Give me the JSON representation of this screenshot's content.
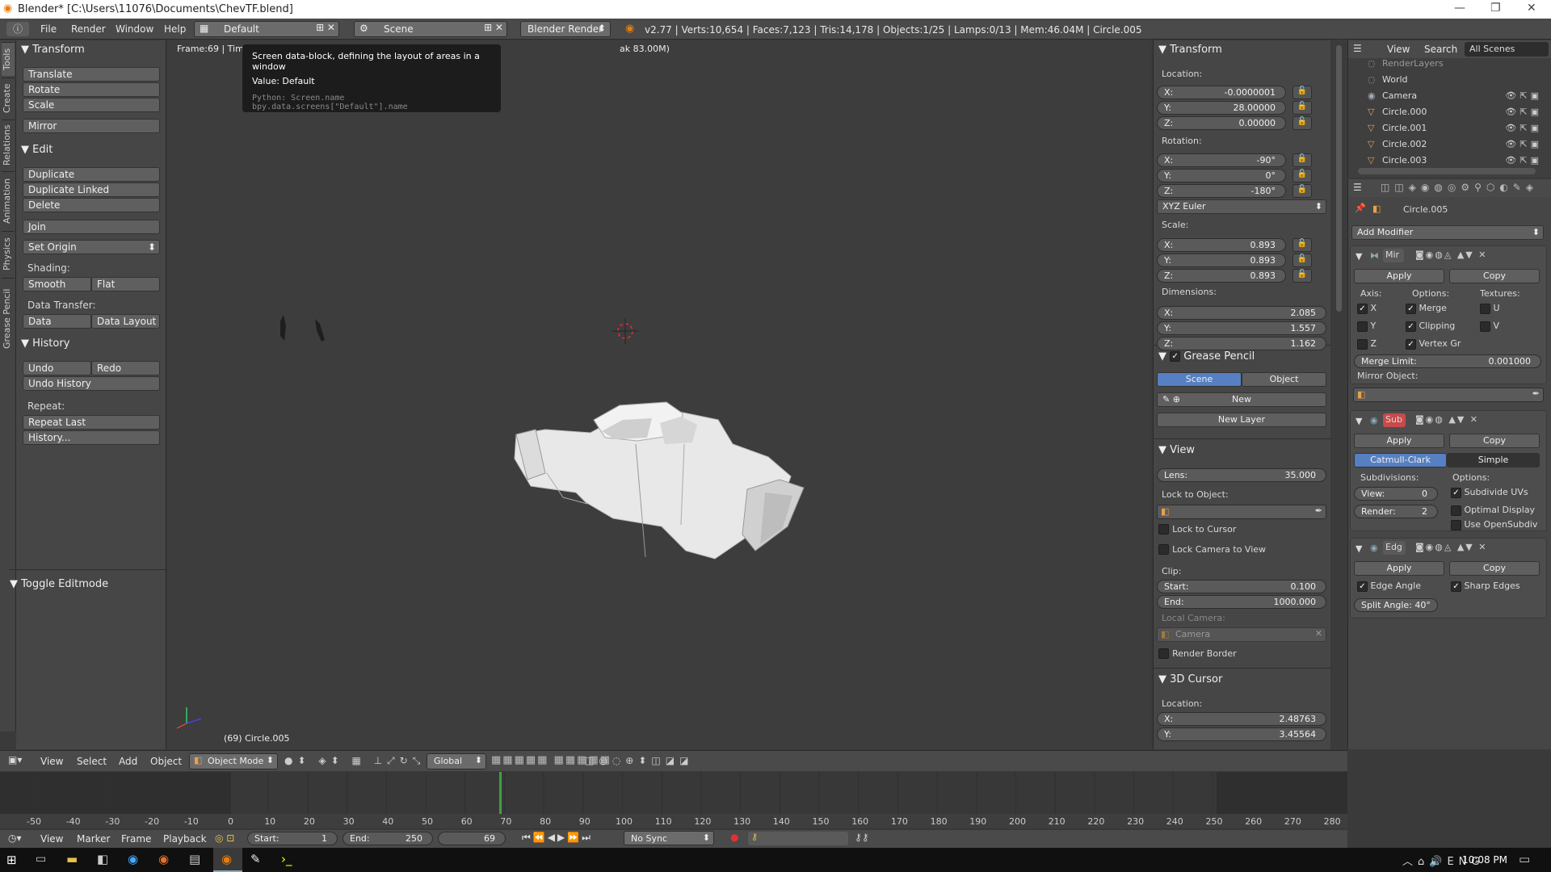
{
  "window": {
    "title": "Blender* [C:\\Users\\11076\\Documents\\ChevTF.blend]"
  },
  "menu": [
    "File",
    "Render",
    "Window",
    "Help"
  ],
  "screen_layout": "Default",
  "scene": "Scene",
  "render_engine": "Blender Render",
  "stats": "v2.77 | Verts:10,654 | Faces:7,123 | Tris:14,178 | Objects:1/25 | Lamps:0/13 | Mem:46.04M | Circle.005",
  "tooltip": {
    "line1": "Screen data-block, defining the layout of areas in a window",
    "line2": "Value: Default",
    "line3": "Python: Screen.name",
    "line4": "bpy.data.screens[\"Default\"].name"
  },
  "viewport": {
    "frame_info": "Frame:69 | Time",
    "frame_tail": "ak 83.00M)",
    "object_label": "(69) Circle.005"
  },
  "toolshelf": {
    "tabs": [
      "Tools",
      "Create",
      "Relations",
      "Animation",
      "Physics",
      "Grease Pencil"
    ],
    "transform": {
      "title": "Transform",
      "buttons": [
        "Translate",
        "Rotate",
        "Scale",
        "Mirror"
      ]
    },
    "edit": {
      "title": "Edit",
      "buttons": [
        "Duplicate",
        "Duplicate Linked",
        "Delete",
        "Join"
      ],
      "set_origin": "Set Origin",
      "shading_label": "Shading:",
      "smooth": "Smooth",
      "flat": "Flat",
      "data_transfer_label": "Data Transfer:",
      "data": "Data",
      "data_layout": "Data Layout"
    },
    "history": {
      "title": "History",
      "undo": "Undo",
      "redo": "Redo",
      "undo_history": "Undo History",
      "repeat_label": "Repeat:",
      "repeat_last": "Repeat Last",
      "history": "History..."
    },
    "toggle": "Toggle Editmode"
  },
  "props": {
    "transform_title": "Transform",
    "location_label": "Location:",
    "location": [
      {
        "k": "X:",
        "v": "-0.0000001"
      },
      {
        "k": "Y:",
        "v": "28.00000"
      },
      {
        "k": "Z:",
        "v": "0.00000"
      }
    ],
    "rotation_label": "Rotation:",
    "rotation": [
      {
        "k": "X:",
        "v": "-90°"
      },
      {
        "k": "Y:",
        "v": "0°"
      },
      {
        "k": "Z:",
        "v": "-180°"
      }
    ],
    "rotation_mode": "XYZ Euler",
    "scale_label": "Scale:",
    "scale": [
      {
        "k": "X:",
        "v": "0.893"
      },
      {
        "k": "Y:",
        "v": "0.893"
      },
      {
        "k": "Z:",
        "v": "0.893"
      }
    ],
    "dimensions_label": "Dimensions:",
    "dimensions": [
      {
        "k": "X:",
        "v": "2.085"
      },
      {
        "k": "Y:",
        "v": "1.557"
      },
      {
        "k": "Z:",
        "v": "1.162"
      }
    ],
    "grease_pencil": "Grease Pencil",
    "gp_scene": "Scene",
    "gp_object": "Object",
    "gp_new": "New",
    "gp_new_layer": "New Layer",
    "view_title": "View",
    "lens_label": "Lens:",
    "lens": "35.000",
    "lock_to_object": "Lock to Object:",
    "lock_to_cursor": "Lock to Cursor",
    "lock_camera": "Lock Camera to View",
    "clip_label": "Clip:",
    "clip_start_k": "Start:",
    "clip_start": "0.100",
    "clip_end_k": "End:",
    "clip_end": "1000.000",
    "local_camera": "Local Camera:",
    "camera": "Camera",
    "render_border": "Render Border",
    "cursor_title": "3D Cursor",
    "cursor_location": "Location:",
    "cursor": [
      {
        "k": "X:",
        "v": "2.48763"
      },
      {
        "k": "Y:",
        "v": "3.45564"
      }
    ]
  },
  "outliner": {
    "view": "View",
    "search": "Search",
    "filter": "All Scenes",
    "items": [
      "RenderLayers",
      "World",
      "Camera",
      "Circle.000",
      "Circle.001",
      "Circle.002",
      "Circle.003"
    ]
  },
  "modifiers": {
    "object": "Circle.005",
    "add": "Add Modifier",
    "mirror": {
      "name": "Mir",
      "apply": "Apply",
      "copy": "Copy",
      "axis": "Axis:",
      "options": "Options:",
      "textures": "Textures:",
      "x": "X",
      "y": "Y",
      "z": "Z",
      "merge": "Merge",
      "clipping": "Clipping",
      "vertex": "Vertex Gr",
      "u": "U",
      "v": "V",
      "merge_limit_k": "Merge Limit:",
      "merge_limit": "0.001000",
      "mirror_object": "Mirror Object:"
    },
    "subsurf": {
      "name": "Sub",
      "apply": "Apply",
      "copy": "Copy",
      "catmull": "Catmull-Clark",
      "simple": "Simple",
      "subdivisions": "Subdivisions:",
      "options": "Options:",
      "view_k": "View:",
      "view": "0",
      "render_k": "Render:",
      "render": "2",
      "uv": "Subdivide UVs",
      "optimal": "Optimal Display",
      "opensubdiv": "Use OpenSubdiv"
    },
    "edge": {
      "name": "Edg",
      "apply": "Apply",
      "copy": "Copy",
      "edge_angle": "Edge Angle",
      "sharp": "Sharp Edges",
      "split": "Split Angle: 40°"
    }
  },
  "vheader": {
    "items": [
      "View",
      "Select",
      "Add",
      "Object"
    ],
    "mode": "Object Mode",
    "orientation": "Global"
  },
  "timeline": {
    "ticks": [
      "-50",
      "-40",
      "-30",
      "-20",
      "-10",
      "0",
      "10",
      "20",
      "30",
      "40",
      "50",
      "60",
      "70",
      "80",
      "90",
      "100",
      "110",
      "120",
      "130",
      "140",
      "150",
      "160",
      "170",
      "180",
      "190",
      "200",
      "210",
      "220",
      "230",
      "240",
      "250",
      "260",
      "270",
      "280"
    ],
    "current_frame": 69
  },
  "theader": {
    "items": [
      "View",
      "Marker",
      "Frame",
      "Playback"
    ],
    "start_k": "Start:",
    "start": "1",
    "end_k": "End:",
    "end": "250",
    "frame": "69",
    "sync": "No Sync"
  },
  "taskbar": {
    "time": "10:08 PM"
  }
}
